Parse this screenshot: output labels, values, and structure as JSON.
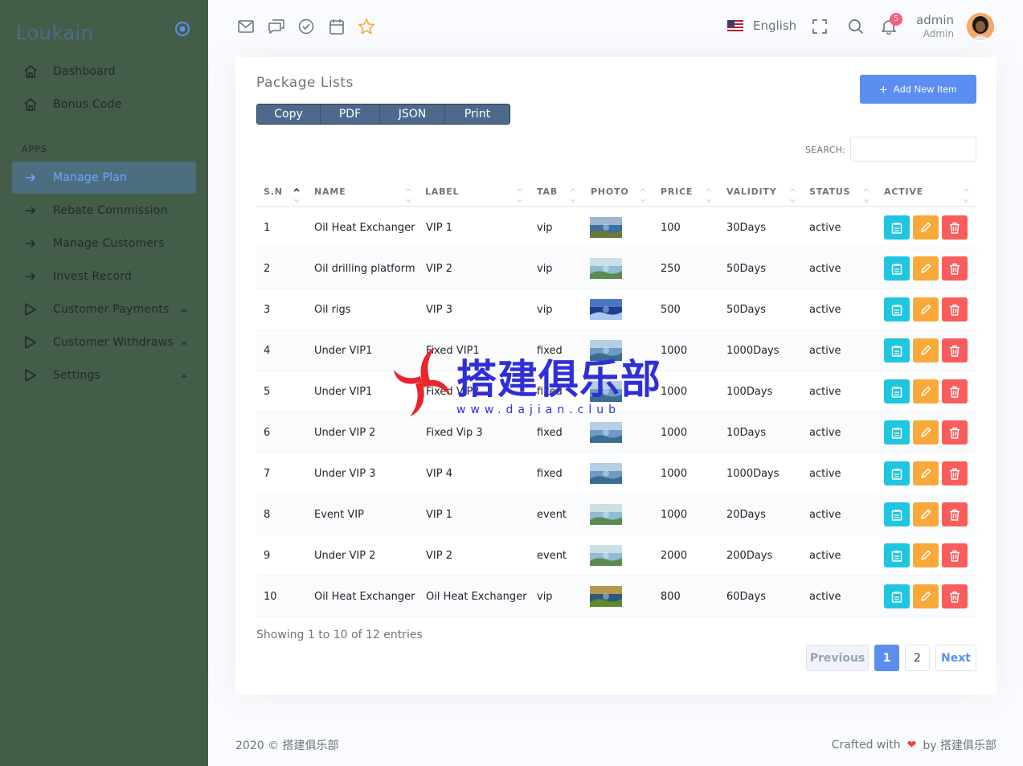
{
  "sidebar": {
    "brand": "Loukain",
    "section_apps": "APPS",
    "items": [
      {
        "label": "Dashboard"
      },
      {
        "label": "Bonus Code"
      },
      {
        "label": "Manage Plan"
      },
      {
        "label": "Rebate Commission"
      },
      {
        "label": "Manage Customers"
      },
      {
        "label": "Invest Record"
      },
      {
        "label": "Customer Payments"
      },
      {
        "label": "Customer Withdraws"
      },
      {
        "label": "Settings"
      }
    ]
  },
  "topbar": {
    "language": "English",
    "notification_count": "5",
    "user_name": "admin",
    "user_role": "Admin"
  },
  "card": {
    "title": "Package Lists",
    "add_button": "Add New Item",
    "export_buttons": [
      "Copy",
      "PDF",
      "JSON",
      "Print"
    ],
    "search_label": "SEARCH:",
    "search_value": ""
  },
  "table": {
    "columns": [
      "S.N",
      "NAME",
      "LABEL",
      "TAB",
      "PHOTO",
      "PRICE",
      "VALIDITY",
      "STATUS",
      "ACTIVE"
    ],
    "rows": [
      {
        "sn": "1",
        "name": "Oil Heat Exchanger",
        "label": "VIP 1",
        "tab": "vip",
        "price": "100",
        "validity": "30Days",
        "status": "active"
      },
      {
        "sn": "2",
        "name": "Oil drilling platform",
        "label": "VIP 2",
        "tab": "vip",
        "price": "250",
        "validity": "50Days",
        "status": "active"
      },
      {
        "sn": "3",
        "name": "Oil rigs",
        "label": "VIP 3",
        "tab": "vip",
        "price": "500",
        "validity": "50Days",
        "status": "active"
      },
      {
        "sn": "4",
        "name": "Under VIP1",
        "label": "Fixed VIP1",
        "tab": "fixed",
        "price": "1000",
        "validity": "1000Days",
        "status": "active"
      },
      {
        "sn": "5",
        "name": "Under VIP1",
        "label": "Fixed VIP2",
        "tab": "fixed",
        "price": "1000",
        "validity": "100Days",
        "status": "active"
      },
      {
        "sn": "6",
        "name": "Under VIP 2",
        "label": "Fixed Vip 3",
        "tab": "fixed",
        "price": "1000",
        "validity": "10Days",
        "status": "active"
      },
      {
        "sn": "7",
        "name": "Under VIP 3",
        "label": "VIP 4",
        "tab": "fixed",
        "price": "1000",
        "validity": "1000Days",
        "status": "active"
      },
      {
        "sn": "8",
        "name": "Event VIP",
        "label": "VIP 1",
        "tab": "event",
        "price": "1000",
        "validity": "20Days",
        "status": "active"
      },
      {
        "sn": "9",
        "name": "Under VIP 2",
        "label": "VIP 2",
        "tab": "event",
        "price": "2000",
        "validity": "200Days",
        "status": "active"
      },
      {
        "sn": "10",
        "name": "Oil Heat Exchanger",
        "label": "Oil Heat Exchanger",
        "tab": "vip",
        "price": "800",
        "validity": "60Days",
        "status": "active"
      }
    ]
  },
  "pagination": {
    "showing": "Showing 1 to 10 of 12 entries",
    "previous": "Previous",
    "pages": [
      "1",
      "2"
    ],
    "next": "Next"
  },
  "watermark": {
    "text": "搭建俱乐部",
    "url": "www.dajian.club"
  },
  "footer": {
    "left": "2020 © 搭建俱乐部",
    "crafted": "Crafted with",
    "by": "by 搭建俱乐部"
  },
  "colors": {
    "sidebar_bg": "#445d48",
    "primary": "#5b8ef0",
    "info": "#1fc6e0",
    "warning": "#f9a93a",
    "danger": "#fa5c5c"
  },
  "icons": {
    "topbar": [
      "mail-icon",
      "chat-icon",
      "check-circle-icon",
      "calendar-icon",
      "star-icon",
      "fullscreen-icon",
      "search-icon",
      "bell-icon"
    ],
    "row_actions": [
      "clipboard-icon",
      "pencil-icon",
      "trash-icon"
    ]
  }
}
